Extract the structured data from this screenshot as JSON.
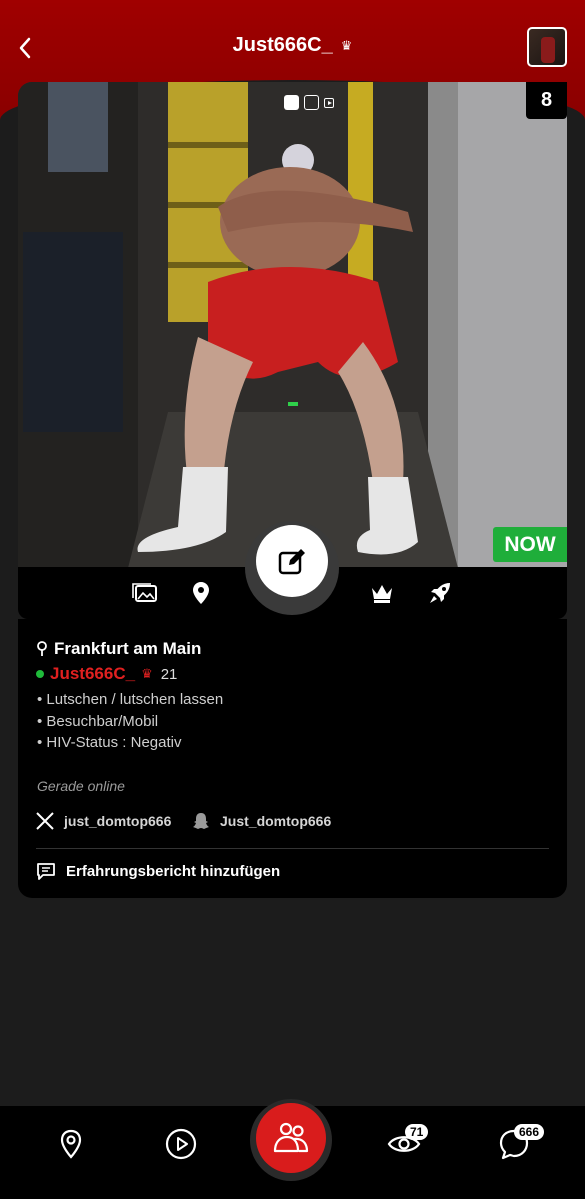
{
  "header": {
    "title": "Just666C_",
    "back_icon": "chevron-left-icon",
    "crown_icon": "crown-icon"
  },
  "photo": {
    "counter": "8",
    "now_label": "NOW",
    "pager": [
      "image",
      "image",
      "video"
    ]
  },
  "actions": [
    "gallery-icon",
    "location-pin-icon",
    "edit-icon",
    "crown-icon",
    "rocket-icon"
  ],
  "profile": {
    "location": "Frankfurt am Main",
    "username": "Just666C_",
    "age": "21",
    "tags": [
      "• Lutschen / lutschen lassen",
      "• Besuchbar/Mobil",
      "• HIV-Status : Negativ"
    ],
    "status": "Gerade online",
    "x_handle": "just_domtop666",
    "snapchat_handle": "Just_domtop666",
    "review_label": "Erfahrungsbericht hinzufügen"
  },
  "nav": {
    "items": [
      "map-pin-icon",
      "play-icon",
      "people-icon",
      "eye-icon",
      "chat-icon"
    ],
    "views_badge": "71",
    "chat_badge": "666"
  },
  "colors": {
    "header_red": "#a00000",
    "accent_red": "#d91c1c",
    "online_green": "#1fbb3a",
    "now_green": "#1fae3a"
  }
}
